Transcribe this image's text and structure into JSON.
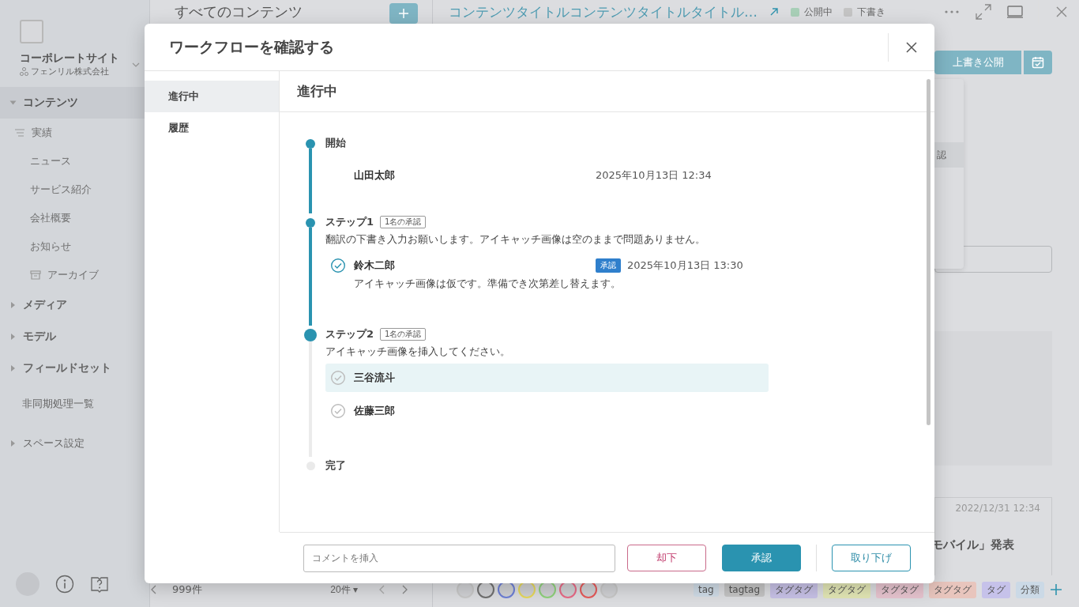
{
  "sidebar": {
    "site_name": "コーポレートサイト",
    "organization": "フェンリル株式会社",
    "nav": [
      {
        "label": "コンテンツ",
        "kind": "group",
        "expanded": true,
        "selected": true,
        "children": [
          {
            "label": "実績",
            "kind": "filter"
          },
          {
            "label": "ニュース",
            "kind": "page"
          },
          {
            "label": "サービス紹介",
            "kind": "page"
          },
          {
            "label": "会社概要",
            "kind": "page"
          },
          {
            "label": "お知らせ",
            "kind": "page"
          },
          {
            "label": "アーカイブ",
            "kind": "archive"
          }
        ]
      },
      {
        "label": "メディア",
        "kind": "group",
        "expanded": false,
        "selected": false
      },
      {
        "label": "モデル",
        "kind": "group",
        "expanded": false,
        "selected": false
      },
      {
        "label": "フィールドセット",
        "kind": "group",
        "expanded": false,
        "selected": false
      },
      {
        "label": "非同期処理一覧",
        "kind": "link",
        "selected": false
      },
      {
        "label": "スペース設定",
        "kind": "section",
        "expanded": false,
        "selected": false
      }
    ]
  },
  "list": {
    "title": "すべてのコンテンツ",
    "count": "999件",
    "per_page": "20件 ▾"
  },
  "editor": {
    "title": "コンテンツタイトルコンテンツタイトルタイトル…",
    "statuses": [
      {
        "label": "公開中",
        "color": "#a8cfb7"
      },
      {
        "label": "下書き",
        "color": "#c4c4c4"
      }
    ],
    "publish_button": "上書き公開",
    "menu": [
      {
        "label": "認",
        "selected": true
      }
    ],
    "card": {
      "date": "2022/12/31 12:34",
      "title": "モバイル」発表"
    },
    "avatars": [
      {
        "color": "#c8c8c8"
      },
      {
        "color": "#707070"
      },
      {
        "color": "#6d7fd6"
      },
      {
        "color": "#e6d85a"
      },
      {
        "color": "#8fd17b"
      },
      {
        "color": "#e86a86"
      },
      {
        "color": "#e65a5a"
      },
      {
        "color": "#c8c8c8"
      }
    ],
    "tags": [
      {
        "label": "tag",
        "color": "#cfdbe6"
      },
      {
        "label": "tagtag",
        "color": "#c4c4c4"
      },
      {
        "label": "タグタグ",
        "color": "#c7c1e6"
      },
      {
        "label": "タグタグ",
        "color": "#e2e6b5"
      },
      {
        "label": "タグタグ",
        "color": "#e7c4cf"
      },
      {
        "label": "タグタグ",
        "color": "#e8c5bd"
      },
      {
        "label": "タグ",
        "color": "#c6c2ea"
      },
      {
        "label": "分類",
        "color": "#cbd9e6"
      }
    ]
  },
  "dialog": {
    "title": "ワークフローを確認する",
    "tabs": [
      {
        "label": "進行中",
        "selected": true
      },
      {
        "label": "履歴",
        "selected": false
      }
    ],
    "section_title": "進行中",
    "timeline": [
      {
        "kind": "start",
        "label": "開始",
        "reached": true,
        "current": false,
        "entries": [
          {
            "name": "山田太郎",
            "date": "2025年10月13日 12:34"
          }
        ]
      },
      {
        "kind": "step",
        "label": "ステップ1",
        "badge": "1名の承認",
        "note": "翻訳の下書き入力お願いします。アイキャッチ画像は空のままで問題ありません。",
        "reached": true,
        "current": false,
        "entries": [
          {
            "name": "鈴木二郎",
            "approved": true,
            "status": "承認",
            "date": "2025年10月13日 13:30",
            "comment": "アイキャッチ画像は仮です。準備でき次第差し替えます。",
            "highlighted": false
          }
        ]
      },
      {
        "kind": "step",
        "label": "ステップ2",
        "badge": "1名の承認",
        "note": "アイキャッチ画像を挿入してください。",
        "reached": true,
        "current": true,
        "entries": [
          {
            "name": "三谷流斗",
            "approved": false,
            "highlighted": true
          },
          {
            "name": "佐藤三郎",
            "approved": false,
            "highlighted": false
          }
        ]
      },
      {
        "kind": "end",
        "label": "完了",
        "reached": false,
        "current": false
      }
    ],
    "comment_placeholder": "コメントを挿入",
    "buttons": [
      {
        "label": "却下",
        "kind": "reject"
      },
      {
        "label": "承認",
        "kind": "approve"
      },
      {
        "label": "取り下げ",
        "kind": "withdraw"
      }
    ]
  }
}
